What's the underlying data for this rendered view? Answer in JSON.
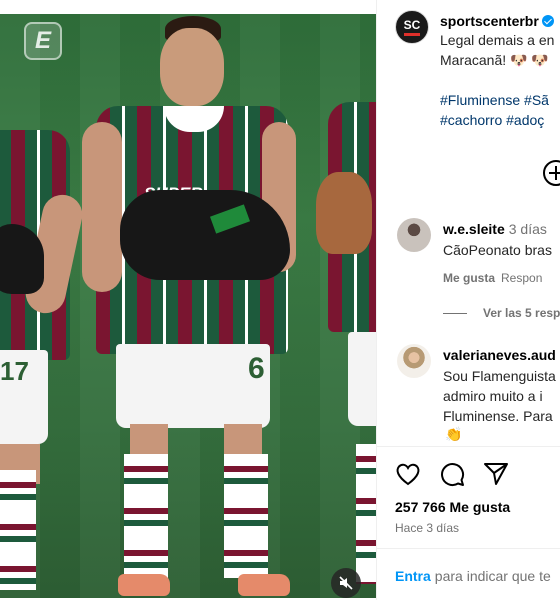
{
  "post": {
    "username": "sportscenterbr",
    "caption_lines": [
      "Legal demais a en",
      "Maracanã! 🐶 🐶"
    ],
    "hashtag_lines": [
      "#Fluminense #Sã",
      "#cachorro #adoç"
    ],
    "sponsor_text": "SUPER",
    "shirt_numbers": [
      "17",
      "6"
    ]
  },
  "comments": [
    {
      "username": "w.e.sleite",
      "time": "3 días",
      "text": "CãoPeonato bras",
      "like_label": "Me gusta",
      "reply_label": "Respon"
    },
    {
      "username": "valerianeves.aud",
      "lines": [
        "Sou Flamenguista",
        "admiro muito a i",
        "Fluminense. Para"
      ],
      "emoji": "👏"
    }
  ],
  "view_replies": "Ver las 5 resp",
  "actions": {
    "likes": "257 766 Me gusta",
    "posted": "Hace 3 días"
  },
  "login": {
    "link": "Entra",
    "text": "para indicar que te"
  },
  "icons": [
    "espn-e-icon",
    "mute-icon",
    "verified-icon",
    "add-comment-icon",
    "heart-icon",
    "comment-icon",
    "share-icon"
  ]
}
